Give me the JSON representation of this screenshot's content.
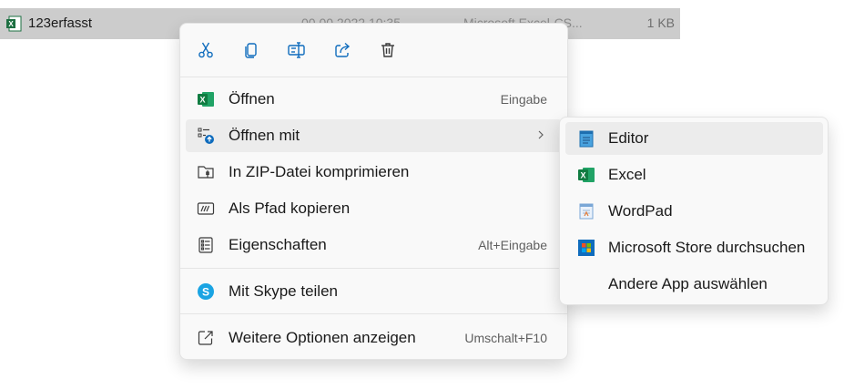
{
  "file": {
    "name": "123erfasst",
    "date": "00.00.2022 10:35",
    "type": "Microsoft Excel-CS...",
    "size": "1 KB"
  },
  "toolbar": {
    "cut_icon": "scissors-icon",
    "copy_icon": "copy-icon",
    "rename_icon": "rename-icon",
    "share_icon": "share-icon",
    "delete_icon": "trash-icon"
  },
  "menu": {
    "items": [
      {
        "label": "Öffnen",
        "shortcut": "Eingabe",
        "icon": "excel-icon"
      },
      {
        "label": "Öffnen mit",
        "shortcut": "",
        "icon": "open-with-icon"
      },
      {
        "label": "In ZIP-Datei komprimieren",
        "shortcut": "",
        "icon": "zip-icon"
      },
      {
        "label": "Als Pfad kopieren",
        "shortcut": "",
        "icon": "copy-path-icon"
      },
      {
        "label": "Eigenschaften",
        "shortcut": "Alt+Eingabe",
        "icon": "properties-icon"
      },
      {
        "label": "Mit Skype teilen",
        "shortcut": "",
        "icon": "skype-icon"
      },
      {
        "label": "Weitere Optionen anzeigen",
        "shortcut": "Umschalt+F10",
        "icon": "more-options-icon"
      }
    ]
  },
  "submenu": {
    "items": [
      {
        "label": "Editor",
        "icon": "notepad-icon"
      },
      {
        "label": "Excel",
        "icon": "excel-icon"
      },
      {
        "label": "WordPad",
        "icon": "wordpad-icon"
      },
      {
        "label": "Microsoft Store durchsuchen",
        "icon": "store-icon"
      },
      {
        "label": "Andere App auswählen",
        "icon": ""
      }
    ]
  },
  "colors": {
    "excel_green": "#1d6f42",
    "accent_blue": "#0f6cbd",
    "skype_blue": "#1aa4e3",
    "selection": "#cccccc"
  }
}
